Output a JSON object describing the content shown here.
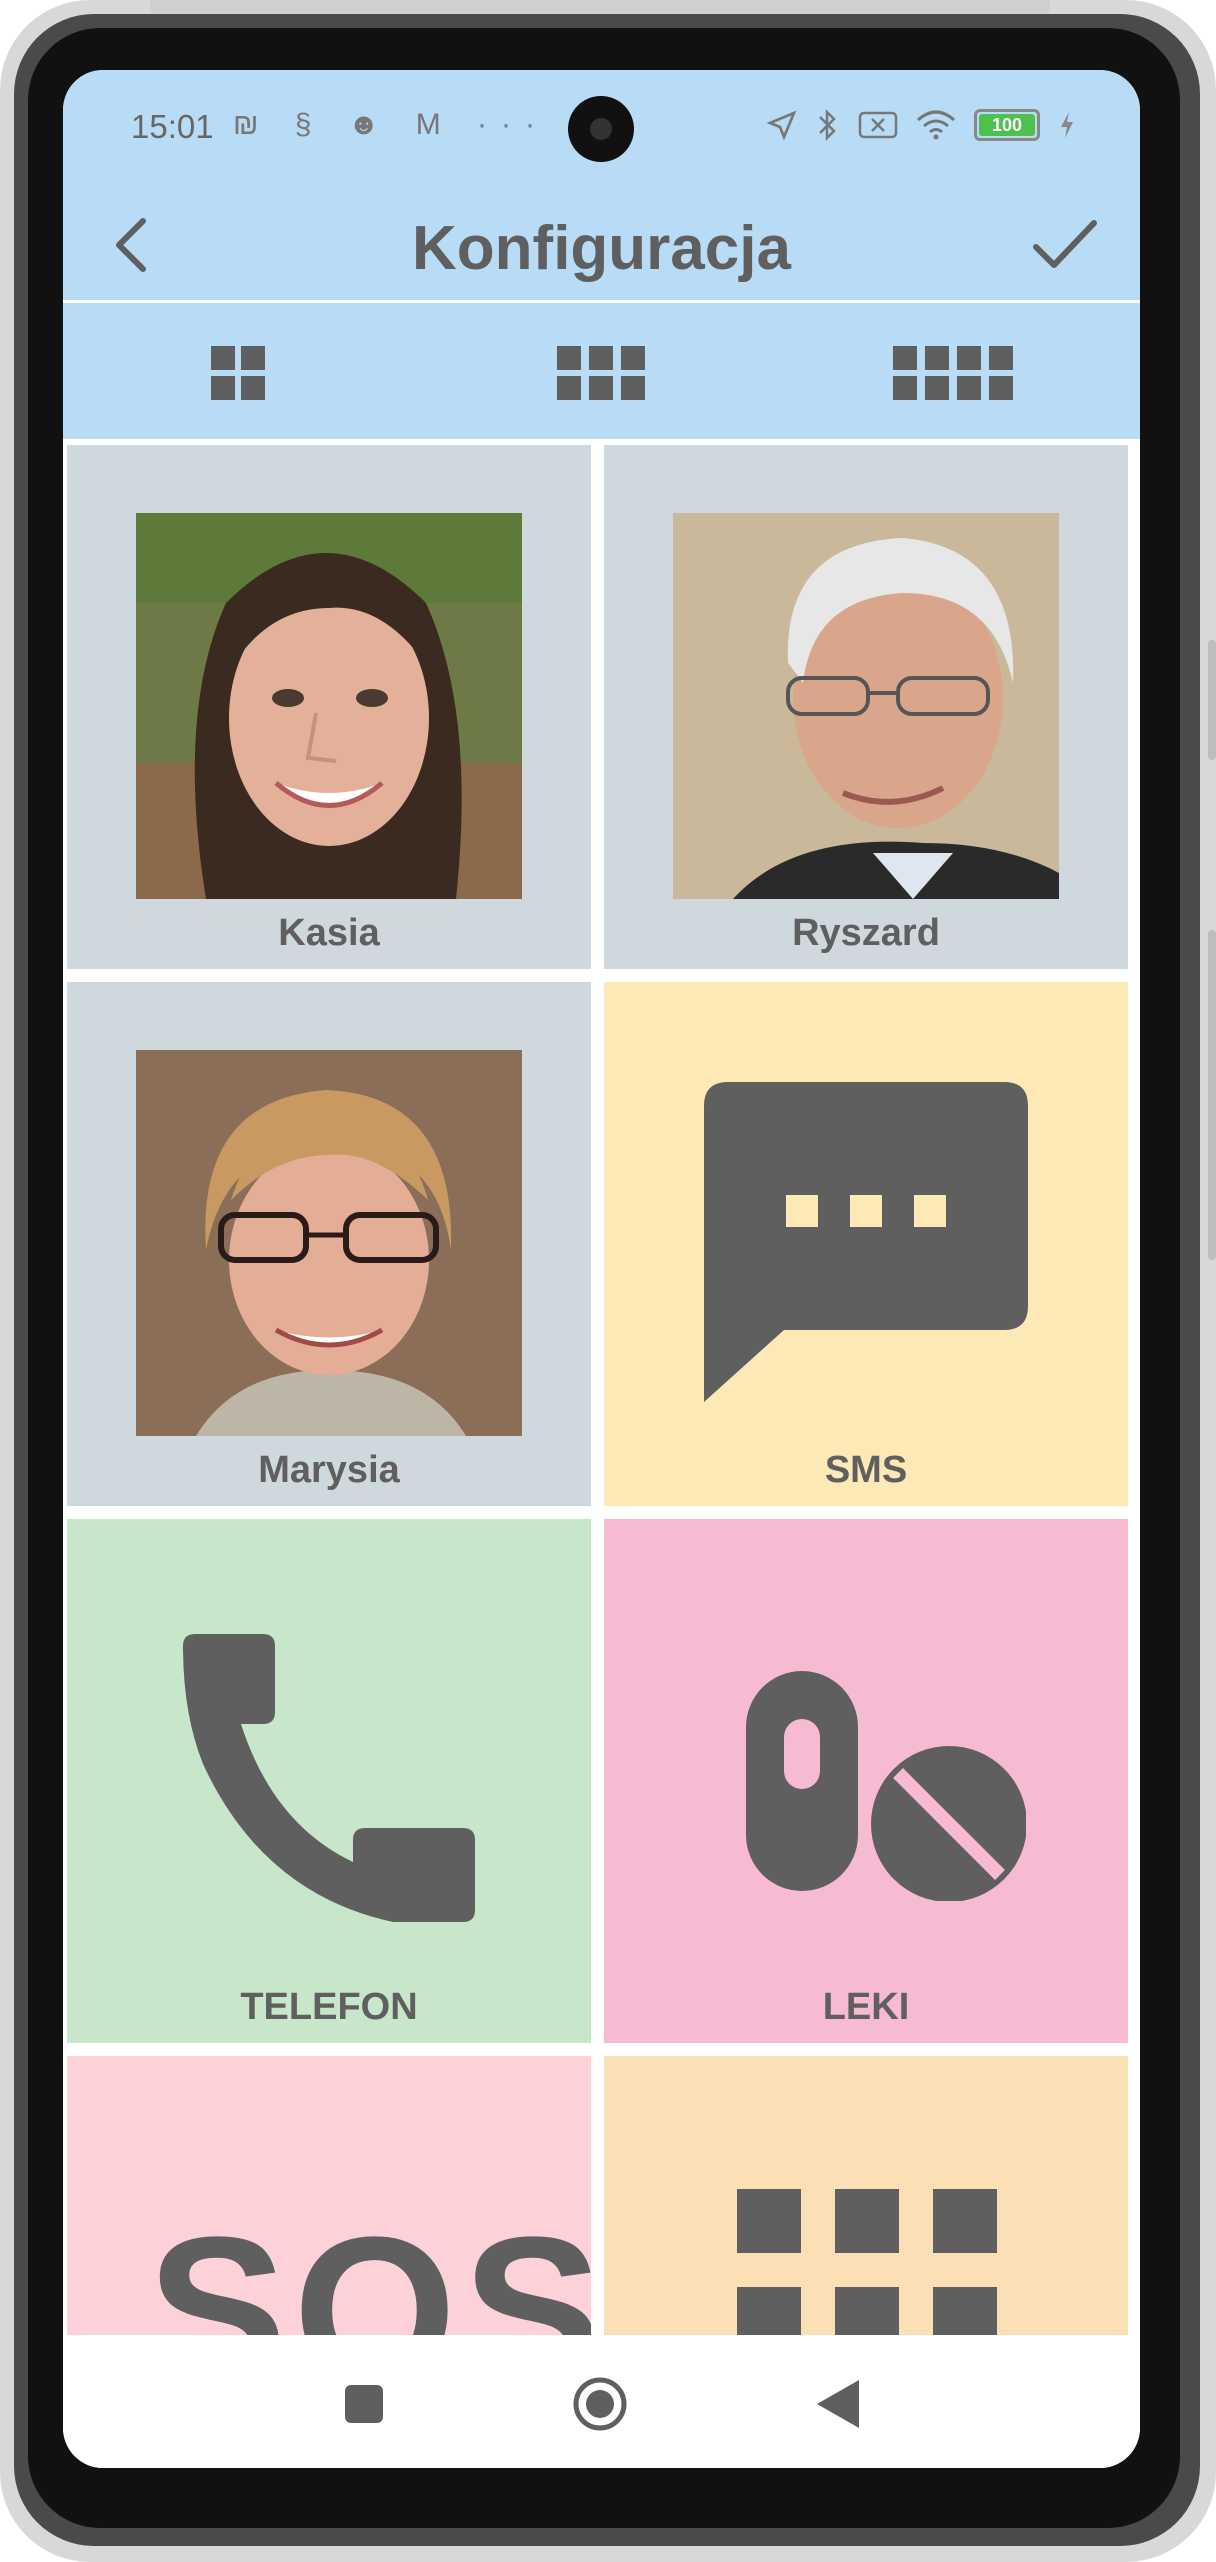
{
  "status_bar": {
    "time": "15:01",
    "left_icons": [
      "nfc-icon",
      "sync-icon",
      "people-icon",
      "gmail-icon",
      "more-dots-icon"
    ],
    "left_icon_glyphs": "₪ § ☻ M ···",
    "right_icons": [
      "location-icon",
      "bluetooth-icon",
      "no-sim-icon",
      "wifi-icon",
      "battery-icon",
      "charging-icon"
    ],
    "battery": "100"
  },
  "header": {
    "title": "Konfiguracja",
    "back_icon": "chevron-left-icon",
    "confirm_icon": "checkmark-icon"
  },
  "grid_options": [
    {
      "name": "grid-2x2-icon",
      "cols": 2
    },
    {
      "name": "grid-3x2-icon",
      "cols": 3
    },
    {
      "name": "grid-4x2-icon",
      "cols": 4
    }
  ],
  "tiles": [
    {
      "label": "Kasia",
      "type": "contact",
      "bg": "#cfd8dd"
    },
    {
      "label": "Ryszard",
      "type": "contact",
      "bg": "#cfd8dd"
    },
    {
      "label": "Marysia",
      "type": "contact",
      "bg": "#cfd8dd"
    },
    {
      "label": "SMS",
      "type": "app",
      "icon": "message-bubble-icon",
      "bg": "#fde9b6"
    },
    {
      "label": "TELEFON",
      "type": "app",
      "icon": "phone-icon",
      "bg": "#c8e6ca"
    },
    {
      "label": "LEKI",
      "type": "app",
      "icon": "pills-icon",
      "bg": "#f6bbd3"
    },
    {
      "label": "",
      "type": "app",
      "icon": "sos-icon",
      "bg": "#fcd1d8",
      "partial_text": "SOS"
    },
    {
      "label": "",
      "type": "app",
      "icon": "apps-grid-icon",
      "bg": "#fce0b5"
    }
  ],
  "nav_bar": {
    "buttons": [
      "recents-square-icon",
      "home-circle-icon",
      "back-triangle-icon"
    ]
  },
  "colors": {
    "header_bg": "#b8dcf5",
    "icon_gray": "#5f5f5f"
  }
}
